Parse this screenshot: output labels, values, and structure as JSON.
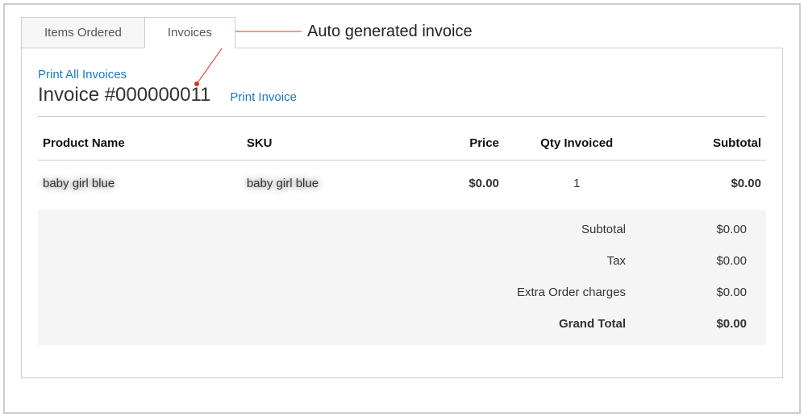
{
  "tabs": {
    "items_ordered": "Items Ordered",
    "invoices": "Invoices"
  },
  "annotation": "Auto generated invoice",
  "links": {
    "print_all": "Print All Invoices",
    "print_one": "Print Invoice"
  },
  "invoice_title": "Invoice #000000011",
  "columns": {
    "product_name": "Product Name",
    "sku": "SKU",
    "price": "Price",
    "qty": "Qty Invoiced",
    "subtotal": "Subtotal"
  },
  "row": {
    "product_name": "baby girl blue",
    "sku": "baby girl blue",
    "price": "$0.00",
    "qty": "1",
    "subtotal": "$0.00"
  },
  "totals": {
    "subtotal_label": "Subtotal",
    "subtotal_value": "$0.00",
    "tax_label": "Tax",
    "tax_value": "$0.00",
    "extra_label": "Extra Order charges",
    "extra_value": "$0.00",
    "grand_label": "Grand Total",
    "grand_value": "$0.00"
  }
}
